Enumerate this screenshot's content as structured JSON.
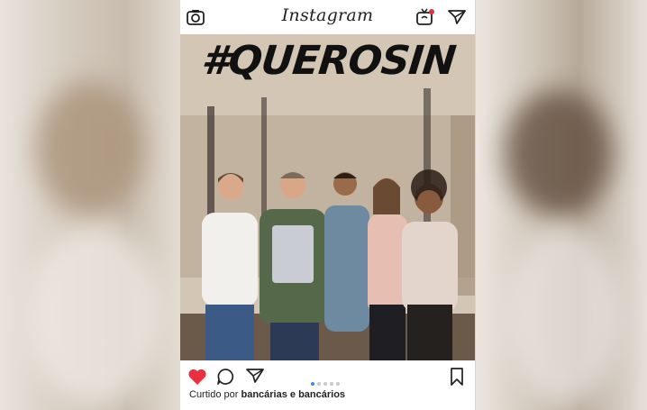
{
  "app": {
    "title": "Instagram"
  },
  "post": {
    "hashtag": "#QUEROSIN",
    "carousel_dots": {
      "count": 5,
      "active_index": 0
    }
  },
  "likes": {
    "prefix": "Curtido por",
    "users": "bancárias e bancários"
  },
  "colors": {
    "heart": "#e8303f",
    "notification_dot": "#e8303f",
    "active_dot": "#3a8cf0",
    "inactive_dot": "#c9c9c9"
  },
  "icons": [
    "camera-icon",
    "igtv-icon",
    "send-icon",
    "heart-icon",
    "comment-icon",
    "share-icon",
    "bookmark-icon"
  ]
}
